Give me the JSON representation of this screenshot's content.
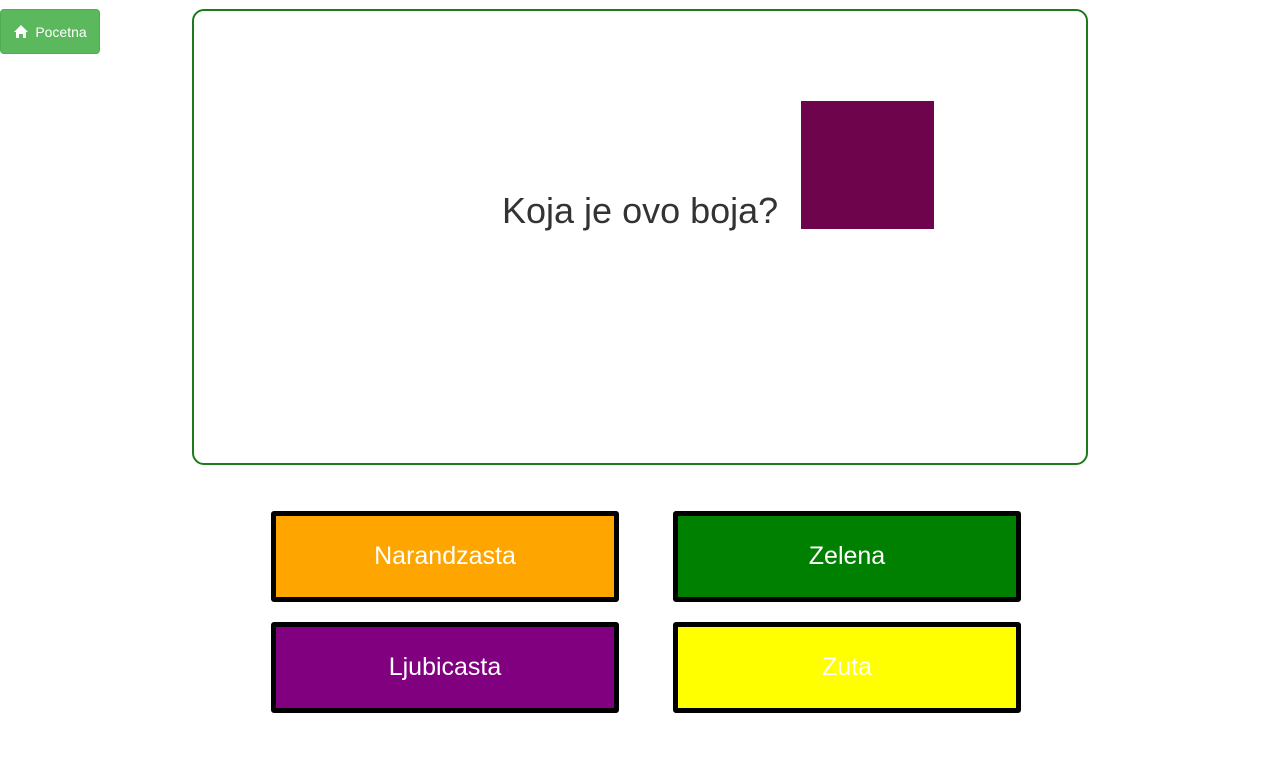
{
  "home_button": {
    "label": "Pocetna",
    "icon": "home-icon"
  },
  "question": {
    "text": "Koja je ovo boja?",
    "swatch_color": "#6d044c"
  },
  "answers": [
    {
      "label": "Narandzasta",
      "color": "#ffa500"
    },
    {
      "label": "Zelena",
      "color": "#008000"
    },
    {
      "label": "Ljubicasta",
      "color": "#800080"
    },
    {
      "label": "Zuta",
      "color": "#ffff00"
    }
  ],
  "colors": {
    "card_border": "#1d7a1d",
    "home_button_bg": "#5cb85c"
  }
}
